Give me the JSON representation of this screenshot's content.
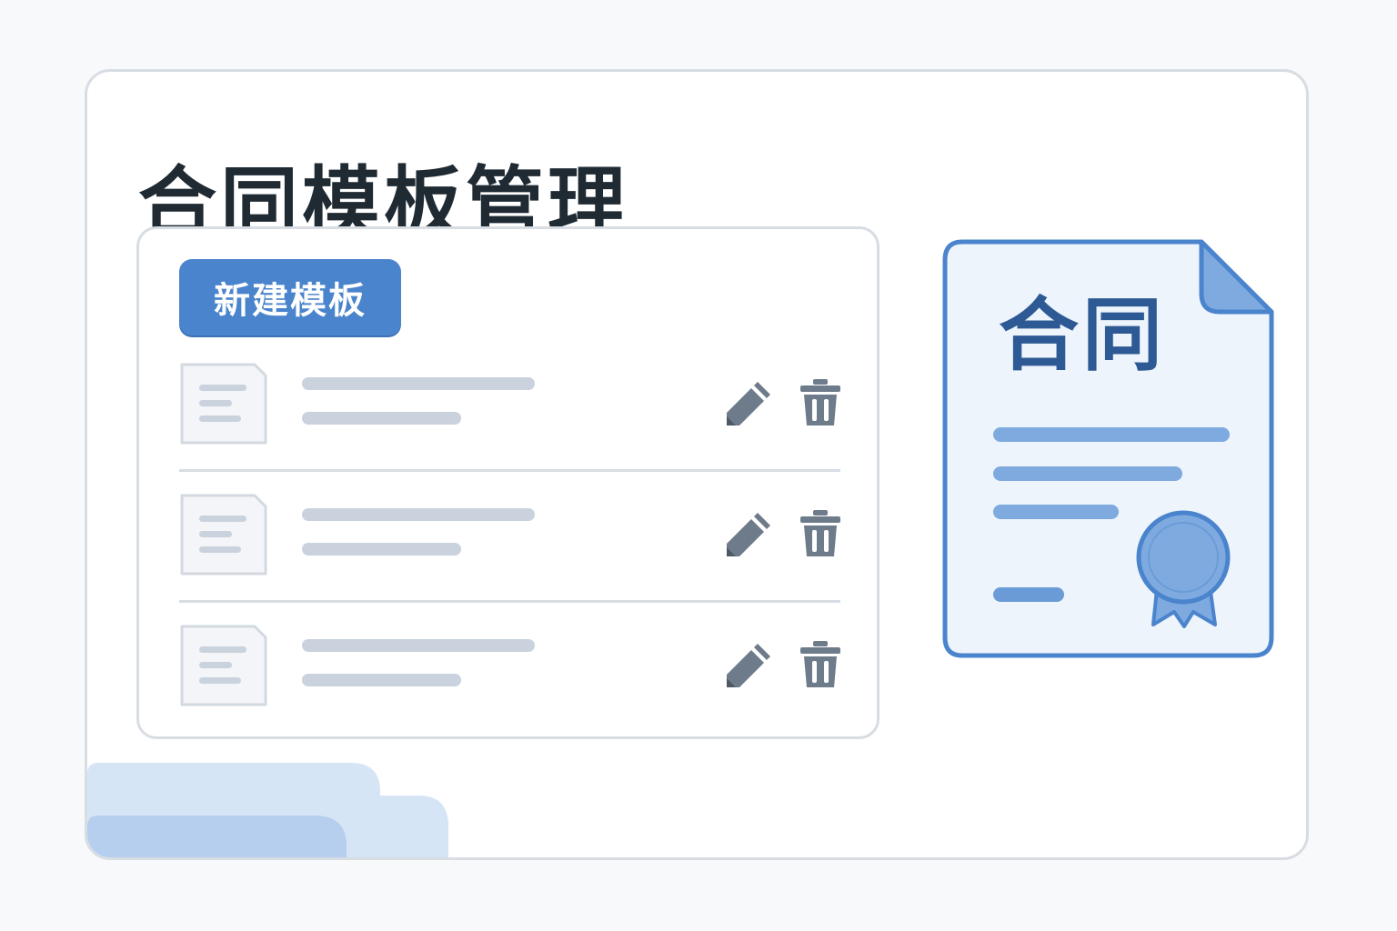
{
  "page": {
    "title": "合同模板管理"
  },
  "toolbar": {
    "new_template_label": "新建模板"
  },
  "templates": {
    "items": [
      {
        "edit_icon": "pencil-icon",
        "delete_icon": "trash-icon"
      },
      {
        "edit_icon": "pencil-icon",
        "delete_icon": "trash-icon"
      },
      {
        "edit_icon": "pencil-icon",
        "delete_icon": "trash-icon"
      }
    ]
  },
  "preview": {
    "title": "合同",
    "icon": "certificate-seal-icon"
  },
  "colors": {
    "accent": "#4a84cc",
    "title_text": "#1f2a33",
    "icon_gray": "#6e7b8a",
    "border": "#d7dde3",
    "preview_fill": "#eef4fc",
    "preview_stroke": "#4a84cc"
  }
}
